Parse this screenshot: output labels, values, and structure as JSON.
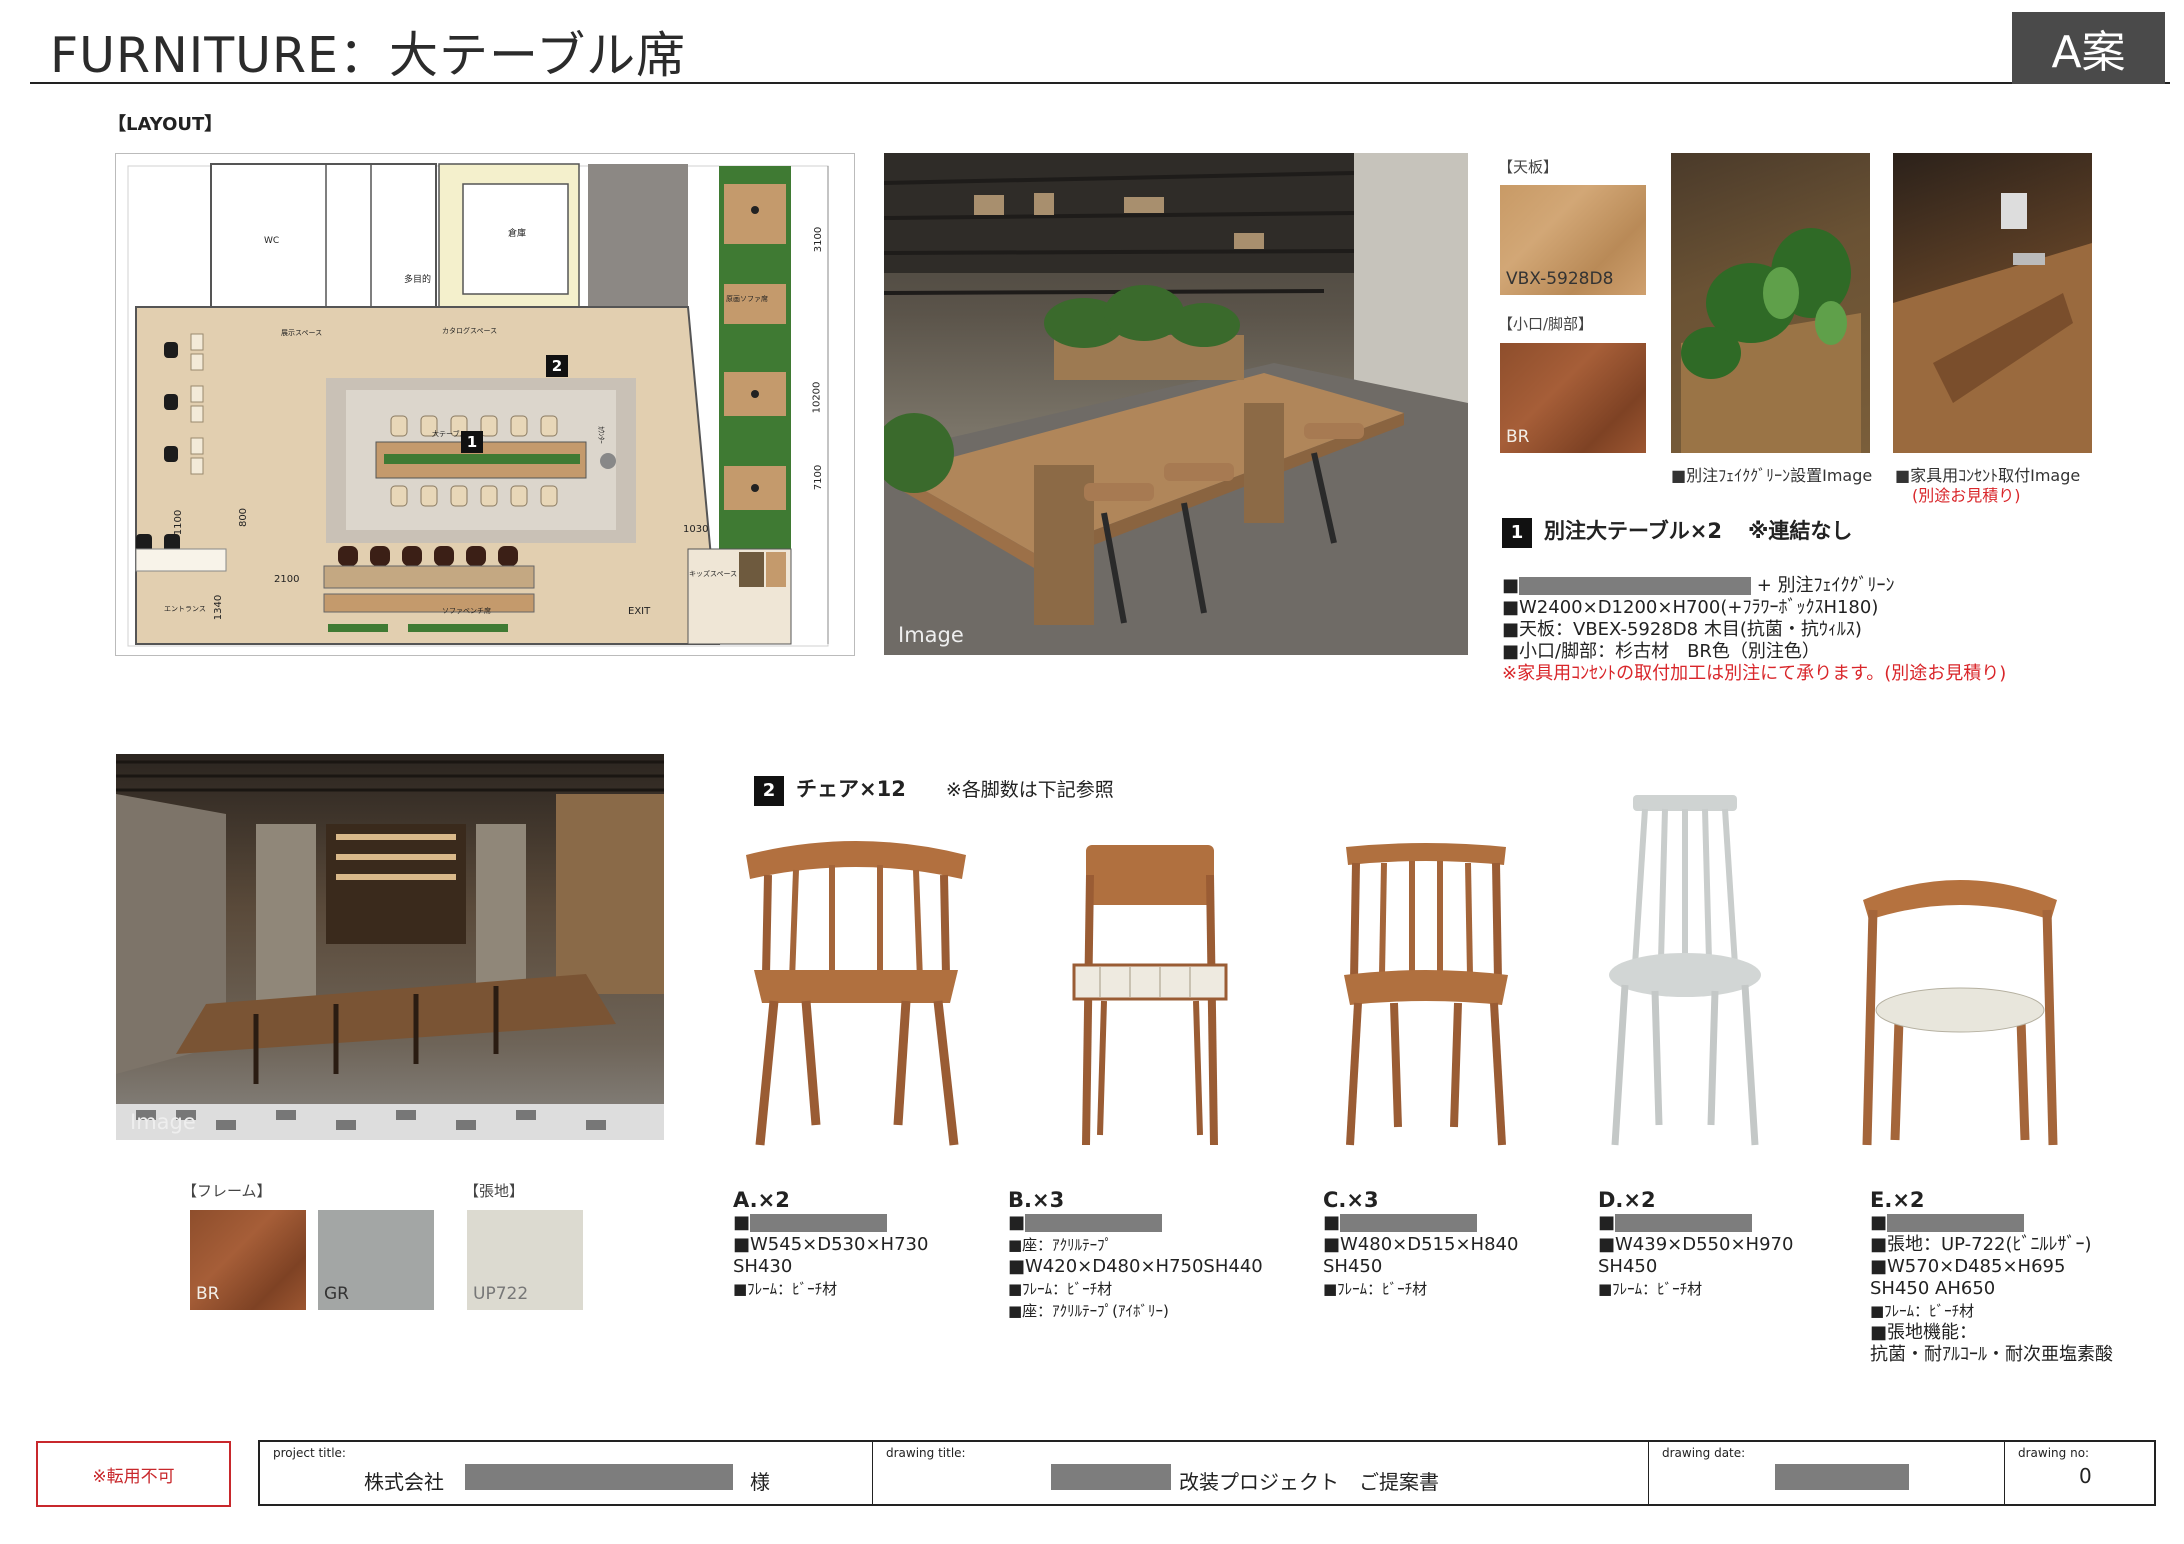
{
  "header": {
    "title": "FURNITURE：大テーブル席",
    "plan_tag": "A案"
  },
  "layout": {
    "label": "【LAYOUT】",
    "rooms": {
      "wc": "WC",
      "storage": "倉庫",
      "multipurpose": "多目的",
      "display": "展示スペース",
      "catalog": "カタログスペース",
      "sofa": "原画ソファ席",
      "kids": "キッズスペース",
      "entrance": "エントランス",
      "sofa_bench": "ソファベンチ席",
      "exit": "EXIT",
      "table": "大テーブル",
      "counter": "ｶｳﾝﾀｰ"
    },
    "dims": {
      "d3100": "3100",
      "d10200": "10200",
      "d7100": "7100",
      "d1100": "1100",
      "d800": "800",
      "d2100": "2100",
      "d1340": "1340",
      "d1030": "1030"
    },
    "markers": {
      "m1": "1",
      "m2": "2"
    }
  },
  "photos": {
    "main": "Image",
    "cafe": "Image"
  },
  "swatches_top": {
    "tenban_label": "【天板】",
    "tenban_code": "VBX-5928D8",
    "koguchi_label": "【小口/脚部】",
    "koguchi_code": "BR"
  },
  "detail_images": {
    "planter_caption": "■別注ﾌｪｲｸｸﾞﾘｰﾝ設置Image",
    "outlet_caption": "■家具用ｺﾝｾﾝﾄ取付Image",
    "outlet_note": "(別途お見積り)"
  },
  "table_spec": {
    "number": "1",
    "title": "別注大テーブル×2",
    "note": "※連結なし",
    "line1_suffix": "+ 別注ﾌｪｲｸｸﾞﾘｰﾝ",
    "line2": "■W2400×D1200×H700(+ﾌﾗﾜｰﾎﾞｯｸｽH180)",
    "line3": "■天板：VBEX-5928D8 木目(抗菌・抗ｳｨﾙｽ)",
    "line4": "■小口/脚部：杉古材　BR色（別注色）",
    "line5": "※家具用ｺﾝｾﾝﾄの取付加工は別注にて承ります。(別途お見積り)"
  },
  "chairs_section": {
    "number": "2",
    "title": "チェア×12",
    "note": "※各脚数は下記参照"
  },
  "chairs": [
    {
      "label": "A.×2",
      "lines": [
        "■W545×D530×H730",
        "SH430"
      ],
      "small": [
        "■ﾌﾚｰﾑ：ﾋﾞｰﾁ材"
      ]
    },
    {
      "label": "B.×3",
      "lines": [],
      "small": [
        "■座：ｱｸﾘﾙﾃｰﾌﾟ"
      ],
      "lines2": [
        "■W420×D480×H750SH440"
      ],
      "small2": [
        "■ﾌﾚｰﾑ：ﾋﾞｰﾁ材",
        "■座：ｱｸﾘﾙﾃｰﾌﾟ(ｱｲﾎﾞﾘｰ)"
      ]
    },
    {
      "label": "C.×3",
      "lines": [
        "■W480×D515×H840",
        "SH450"
      ],
      "small": [
        "■ﾌﾚｰﾑ：ﾋﾞｰﾁ材"
      ]
    },
    {
      "label": "D.×2",
      "lines": [
        "■W439×D550×H970",
        "SH450"
      ],
      "small": [
        "■ﾌﾚｰﾑ：ﾋﾞｰﾁ材"
      ]
    },
    {
      "label": "E.×2",
      "lines": [
        "■張地：UP-722(ﾋﾞﾆﾙﾚｻﾞｰ)",
        "■W570×D485×H695",
        "SH450 AH650"
      ],
      "small": [
        "■ﾌﾚｰﾑ：ﾋﾞｰﾁ材"
      ],
      "lines2": [
        "■張地機能：",
        "抗菌・耐ｱﾙｺｰﾙ・耐次亜塩素酸"
      ]
    }
  ],
  "swatches_bottom": {
    "frame_label": "【フレーム】",
    "fabric_label": "【張地】",
    "br": "BR",
    "gr": "GR",
    "up": "UP722"
  },
  "footer": {
    "stamp": "※転用不可",
    "project_label": "project title:",
    "project_prefix": "株式会社",
    "project_suffix": "様",
    "drawing_title_label": "drawing title:",
    "drawing_title": "改装プロジェクト　ご提案書",
    "date_label": "drawing date:",
    "no_label": "drawing no:",
    "no": "0"
  },
  "colors": {
    "accent_dark": "#4a4a4a",
    "redact": "#7d7d7d",
    "warning_red": "#d9262a",
    "green_bed": "#3f7a33",
    "wood": "#c49a6c"
  }
}
